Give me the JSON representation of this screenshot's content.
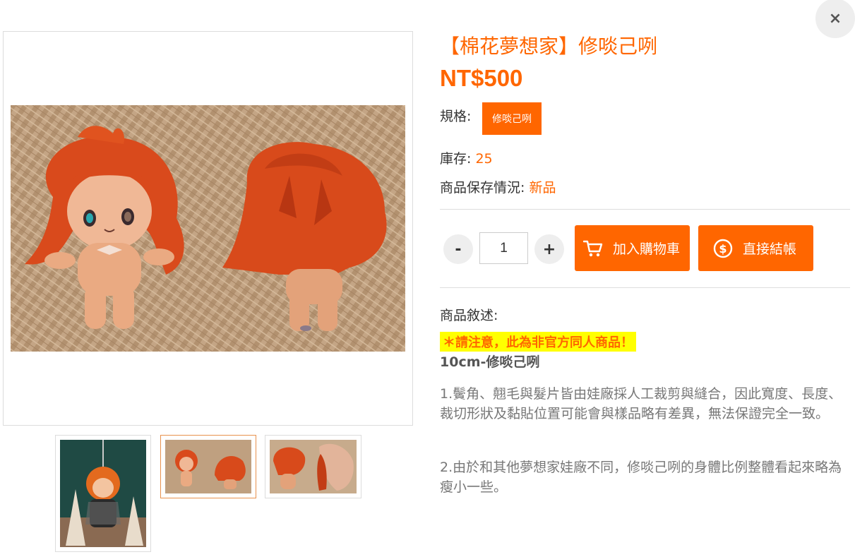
{
  "close_label": "×",
  "product": {
    "title": "【棉花夢想家】修啖己咧",
    "price": "NT$500",
    "spec_label": "規格:",
    "spec_option": "修啖己咧",
    "stock_label": "庫存:",
    "stock_value": "25",
    "condition_label": "商品保存情況:",
    "condition_value": "新品"
  },
  "purchase": {
    "minus_label": "-",
    "plus_label": "+",
    "quantity": "1",
    "add_to_cart_label": "加入購物車",
    "checkout_label": "直接結帳"
  },
  "description": {
    "label": "商品敘述:",
    "notice": "＊請注意，此為非官方同人商品！",
    "subheading": "10cm-修啖己咧",
    "paragraphs": [
      "1.鬢角、翹毛與髮片皆由娃廠採人工裁剪與縫合，因此寬度、長度、裁切形狀及黏貼位置可能會與樣品略有差異，無法保證完全一致。",
      "2.由於和其他夢想家娃廠不同，修啖己咧的身體比例整體看起來略為瘦小一些。"
    ]
  },
  "gallery": {
    "thumbnails": [
      "plush-keychain-photo",
      "two-plush-dolls-photo",
      "plush-closeup-photo"
    ],
    "active_index": 1
  },
  "colors": {
    "accent": "#ff6600",
    "notice_bg": "#ffff00",
    "active_thumb_border": "#e8914d"
  }
}
